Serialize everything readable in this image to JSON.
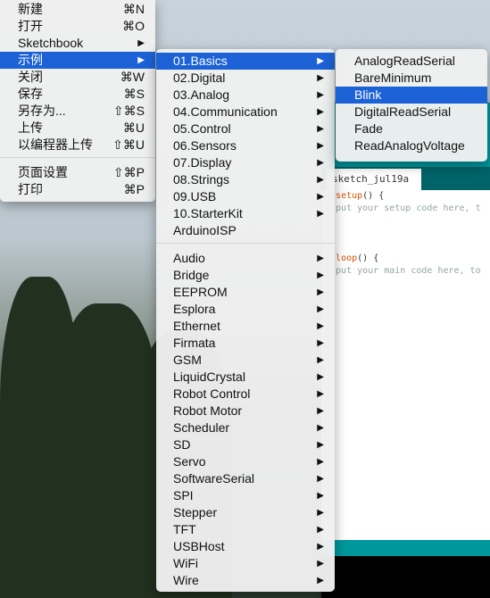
{
  "file_menu": {
    "items": [
      {
        "label": "新建",
        "shortcut": "⌘N"
      },
      {
        "label": "打开",
        "shortcut": "⌘O"
      },
      {
        "label": "Sketchbook",
        "submenu": true
      },
      {
        "label": "示例",
        "submenu": true,
        "highlighted": true
      },
      {
        "label": "关闭",
        "shortcut": "⌘W"
      },
      {
        "label": "保存",
        "shortcut": "⌘S"
      },
      {
        "label": "另存为...",
        "shortcut": "⇧⌘S"
      },
      {
        "label": "上传",
        "shortcut": "⌘U"
      },
      {
        "label": "以编程器上传",
        "shortcut": "⇧⌘U"
      },
      {
        "label": "页面设置",
        "shortcut": "⇧⌘P"
      },
      {
        "label": "打印",
        "shortcut": "⌘P"
      }
    ]
  },
  "examples_menu": {
    "items": [
      "01.Basics",
      "02.Digital",
      "03.Analog",
      "04.Communication",
      "05.Control",
      "06.Sensors",
      "07.Display",
      "08.Strings",
      "09.USB",
      "10.StarterKit",
      "ArduinoISP",
      "Audio",
      "Bridge",
      "EEPROM",
      "Esplora",
      "Ethernet",
      "Firmata",
      "GSM",
      "LiquidCrystal",
      "Robot Control",
      "Robot Motor",
      "Scheduler",
      "SD",
      "Servo",
      "SoftwareSerial",
      "SPI",
      "Stepper",
      "TFT",
      "USBHost",
      "WiFi",
      "Wire"
    ]
  },
  "basics_menu": {
    "items": [
      "AnalogReadSerial",
      "BareMinimum",
      "Blink",
      "DigitalReadSerial",
      "Fade",
      "ReadAnalogVoltage"
    ]
  },
  "editor": {
    "tab_name": "sketch_jul19a",
    "line1_kw": "d ",
    "line1_fn": "setup",
    "line1_rest": "() {",
    "line2": "/ put your setup code here, t",
    "line5_kw": "d ",
    "line5_fn": "loop",
    "line5_rest": "() {",
    "line6": "/ put your main code here, to"
  },
  "arrow_glyph": "▶",
  "colors": {
    "highlight": "#1c62d6",
    "arduino_teal": "#00979c"
  }
}
